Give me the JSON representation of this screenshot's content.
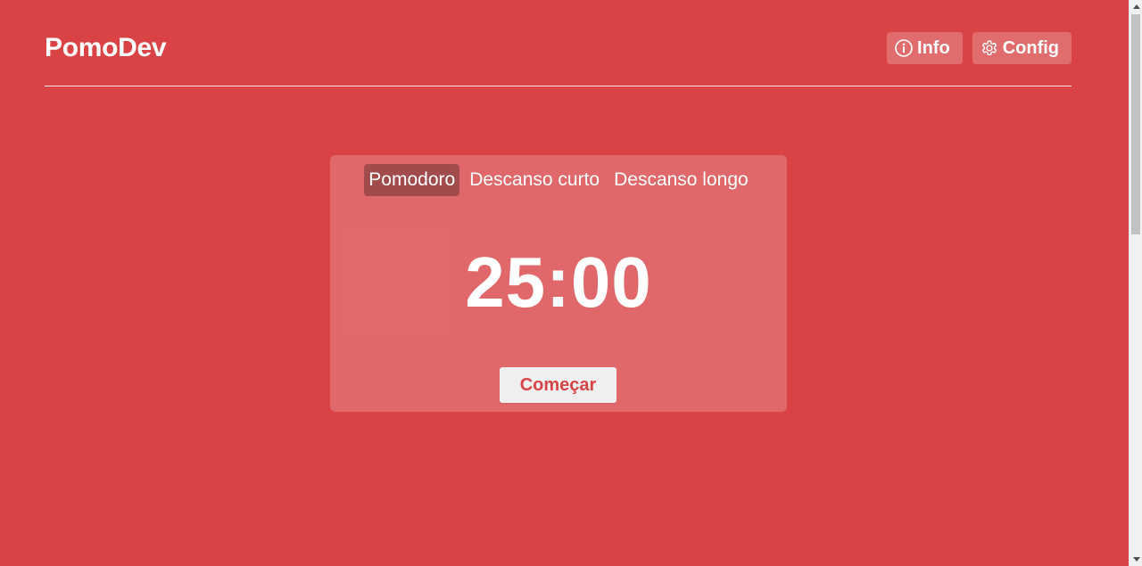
{
  "header": {
    "logo": "PomoDev",
    "nav": [
      {
        "label": "Info",
        "icon": "info-circle-icon"
      },
      {
        "label": "Config",
        "icon": "gear-icon"
      }
    ]
  },
  "timer": {
    "tabs": [
      {
        "label": "Pomodoro",
        "active": true
      },
      {
        "label": "Descanso curto",
        "active": false
      },
      {
        "label": "Descanso longo",
        "active": false
      }
    ],
    "time": "25:00",
    "start_label": "Começar"
  },
  "colors": {
    "background": "#d94345",
    "card": "rgba(255,255,255,0.2)",
    "active_tab": "rgba(0,0,0,0.28)",
    "start_button_bg": "#efefef",
    "start_button_text": "#d94345"
  }
}
